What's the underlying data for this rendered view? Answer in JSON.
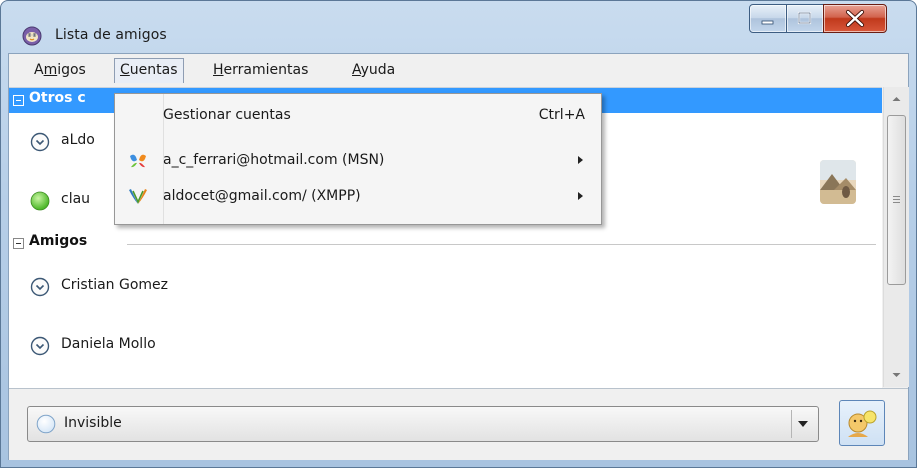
{
  "window": {
    "title": "Lista de amigos"
  },
  "menu": [
    {
      "label": "Amigos",
      "accel_index": 1
    },
    {
      "label": "Cuentas",
      "accel_index": 0
    },
    {
      "label": "Herramientas",
      "accel_index": 0
    },
    {
      "label": "Ayuda",
      "accel_index": 0
    }
  ],
  "groups": {
    "others": {
      "label": "Otros c"
    },
    "friends": {
      "label": "Amigos"
    }
  },
  "contacts": {
    "c1": {
      "name": "aLdo"
    },
    "c2": {
      "name": "clau"
    },
    "c3": {
      "name": "Cristian Gomez"
    },
    "c4": {
      "name": "Daniela Mollo"
    }
  },
  "status": {
    "current": "Invisible"
  },
  "dropdown": {
    "manage": {
      "label": "Gestionar cuentas",
      "shortcut": "Ctrl+A"
    },
    "msn": {
      "label": "a_c_ferrari@hotmail.com (MSN)",
      "icon": "msn-butterfly-icon"
    },
    "xmpp": {
      "label": "aldocet@gmail.com/ (XMPP)",
      "icon": "xmpp-icon"
    }
  },
  "colors": {
    "selection": "#3399ff",
    "available": "#5fc63a",
    "close_button": "#c0391c"
  }
}
